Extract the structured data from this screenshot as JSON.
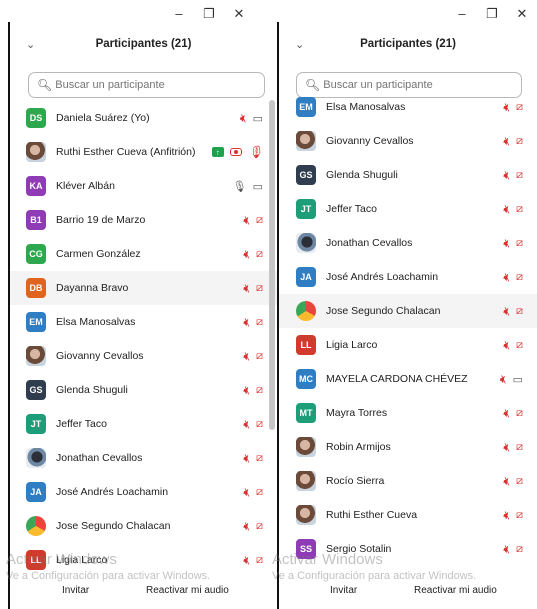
{
  "window_controls": {
    "minimize": "–",
    "maximize": "❐",
    "close": "✕"
  },
  "left": {
    "title": "Participantes (21)",
    "search_placeholder": "Buscar un participante",
    "participants": [
      {
        "initials": "DS",
        "name": "Daniela Suárez (Yo)",
        "color": "#2ea84e",
        "mic": "muted",
        "cam": "on"
      },
      {
        "initials": "",
        "name": "Ruthi Esther Cueva (Anfitrión)",
        "photo": "photo",
        "mic": "muted-host",
        "cam": "rec"
      },
      {
        "initials": "KA",
        "name": "Kléver Albán",
        "color": "#8e3bb5",
        "mic": "on",
        "cam": "on"
      },
      {
        "initials": "B1",
        "name": "Barrio 19 de Marzo",
        "color": "#8e3bb5",
        "mic": "muted",
        "cam": "off"
      },
      {
        "initials": "CG",
        "name": "Carmen González",
        "color": "#2ea84e",
        "mic": "muted",
        "cam": "off"
      },
      {
        "initials": "DB",
        "name": "Dayanna Bravo",
        "color": "#e0641e",
        "mic": "muted",
        "cam": "off",
        "highlight": true
      },
      {
        "initials": "EM",
        "name": "Elsa Manosalvas",
        "color": "#2f7ec4",
        "mic": "muted",
        "cam": "off"
      },
      {
        "initials": "",
        "name": "Giovanny Cevallos",
        "photo": "photo",
        "mic": "muted",
        "cam": "off"
      },
      {
        "initials": "GS",
        "name": "Glenda Shuguli",
        "color": "#2f3d4e",
        "mic": "muted",
        "cam": "off"
      },
      {
        "initials": "JT",
        "name": "Jeffer Taco",
        "color": "#1e9e78",
        "mic": "muted",
        "cam": "off"
      },
      {
        "initials": "",
        "name": "Jonathan Cevallos",
        "photo": "dark",
        "mic": "muted",
        "cam": "off"
      },
      {
        "initials": "JA",
        "name": "José Andrés Loachamin",
        "color": "#2f7ec4",
        "mic": "muted",
        "cam": "off"
      },
      {
        "initials": "",
        "name": "Jose Segundo Chalacan",
        "photo": "chrome",
        "mic": "muted",
        "cam": "off"
      },
      {
        "initials": "LL",
        "name": "Ligia Larco",
        "color": "#d23a2e",
        "mic": "muted",
        "cam": "off"
      }
    ],
    "footer": {
      "invite": "Invitar",
      "unmute": "Reactivar mi audio"
    }
  },
  "right": {
    "title": "Participantes (21)",
    "search_placeholder": "Buscar un participante",
    "participants": [
      {
        "initials": "EM",
        "name": "Elsa Manosalvas",
        "color": "#2f7ec4",
        "mic": "muted",
        "cam": "off"
      },
      {
        "initials": "",
        "name": "Giovanny Cevallos",
        "photo": "photo",
        "mic": "muted",
        "cam": "off"
      },
      {
        "initials": "GS",
        "name": "Glenda Shuguli",
        "color": "#2f3d4e",
        "mic": "muted",
        "cam": "off"
      },
      {
        "initials": "JT",
        "name": "Jeffer Taco",
        "color": "#1e9e78",
        "mic": "muted",
        "cam": "off"
      },
      {
        "initials": "",
        "name": "Jonathan Cevallos",
        "photo": "dark",
        "mic": "muted",
        "cam": "off"
      },
      {
        "initials": "JA",
        "name": "José Andrés Loachamin",
        "color": "#2f7ec4",
        "mic": "muted",
        "cam": "off"
      },
      {
        "initials": "",
        "name": "Jose Segundo Chalacan",
        "photo": "chrome",
        "mic": "muted",
        "cam": "off",
        "highlight": true
      },
      {
        "initials": "LL",
        "name": "Ligia Larco",
        "color": "#d23a2e",
        "mic": "muted",
        "cam": "off"
      },
      {
        "initials": "MC",
        "name": "MAYELA CARDONA CHÉVEZ",
        "color": "#2f7ec4",
        "mic": "muted",
        "cam": "on"
      },
      {
        "initials": "MT",
        "name": "Mayra Torres",
        "color": "#1e9e78",
        "mic": "muted",
        "cam": "off"
      },
      {
        "initials": "",
        "name": "Robin Armijos",
        "photo": "photo",
        "mic": "muted",
        "cam": "off"
      },
      {
        "initials": "",
        "name": "Rocío Sierra",
        "photo": "photo",
        "mic": "muted",
        "cam": "off"
      },
      {
        "initials": "",
        "name": "Ruthi Esther Cueva",
        "photo": "photo",
        "mic": "muted",
        "cam": "off"
      },
      {
        "initials": "SS",
        "name": "Sergio Sotalin",
        "color": "#8e3bb5",
        "mic": "muted",
        "cam": "off"
      }
    ],
    "footer": {
      "invite": "Invitar",
      "unmute": "Reactivar mi audio"
    }
  },
  "watermark": {
    "line1": "Activar Windows",
    "line2": "Ve a Configuración para activar Windows."
  },
  "icons": {
    "chevron": "chevron-down-icon",
    "search": "search-icon",
    "mic_muted": "mic-muted-icon",
    "cam_off": "camera-off-icon"
  }
}
